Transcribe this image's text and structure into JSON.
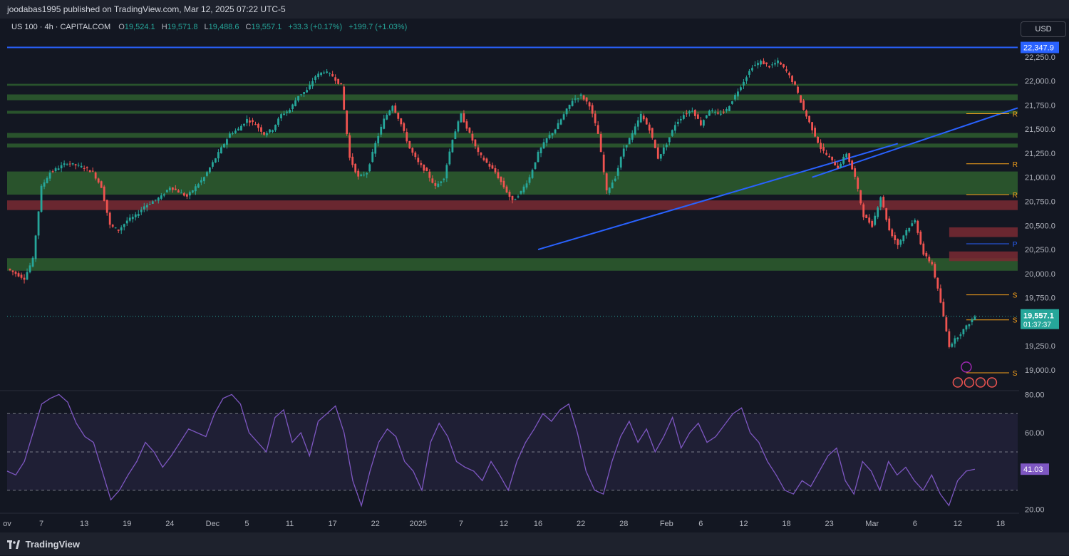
{
  "header": {
    "published_text": "joodabas1995 published on TradingView.com, Mar 12, 2025 07:22 UTC-5"
  },
  "legend": {
    "symbol": "US 100 · 4h · CAPITALCOM",
    "open_label": "O",
    "open": "19,524.1",
    "high_label": "H",
    "high": "19,571.8",
    "low_label": "L",
    "low": "19,488.6",
    "close_label": "C",
    "close": "19,557.1",
    "change": "+33.3 (+0.17%)",
    "change_2": "+199.7 (+1.03%)"
  },
  "currency_button": "USD",
  "footer": {
    "brand": "TradingView"
  },
  "colors": {
    "bg": "#131722",
    "up": "#26a69a",
    "down": "#ef5350",
    "green_zone": "#2e5e2e",
    "red_zone": "#7a2a33",
    "blue_line": "#2962ff",
    "orange": "#f7a21b",
    "rsi": "#7e57c2",
    "grid": "#2a2e39"
  },
  "chart_data": [
    {
      "type": "candlestick",
      "ylim": [
        18800,
        22500
      ],
      "y_ticks": [
        "22,250.0",
        "22,000.0",
        "21,750.0",
        "21,500.0",
        "21,250.0",
        "21,000.0",
        "20,750.0",
        "20,500.0",
        "20,250.0",
        "20,000.0",
        "19,750.0",
        "19,250.0",
        "19,000.0"
      ],
      "y_tick_values": [
        22250,
        22000,
        21750,
        21500,
        21250,
        21000,
        20750,
        20500,
        20250,
        20000,
        19750,
        19250,
        19000
      ],
      "x_ticks": [
        "ov",
        "7",
        "13",
        "19",
        "24",
        "Dec",
        "5",
        "11",
        "17",
        "22",
        "2025",
        "7",
        "12",
        "16",
        "22",
        "28",
        "Feb",
        "6",
        "12",
        "18",
        "23",
        "Mar",
        "6",
        "12",
        "18"
      ],
      "x_tick_index": [
        0,
        4,
        9,
        14,
        19,
        24,
        28,
        33,
        38,
        43,
        48,
        53,
        58,
        62,
        67,
        72,
        77,
        81,
        86,
        91,
        96,
        101,
        106,
        111,
        116
      ],
      "price_path": [
        [
          0,
          20050
        ],
        [
          2,
          19950
        ],
        [
          3,
          20150
        ],
        [
          4,
          20900
        ],
        [
          5,
          21050
        ],
        [
          7,
          21150
        ],
        [
          9,
          21100
        ],
        [
          10,
          21050
        ],
        [
          11,
          20900
        ],
        [
          12,
          20500
        ],
        [
          13,
          20450
        ],
        [
          14,
          20550
        ],
        [
          15,
          20600
        ],
        [
          16,
          20700
        ],
        [
          17,
          20750
        ],
        [
          18,
          20800
        ],
        [
          19,
          20900
        ],
        [
          20,
          20850
        ],
        [
          21,
          20800
        ],
        [
          22,
          20900
        ],
        [
          23,
          21000
        ],
        [
          24,
          21150
        ],
        [
          25,
          21300
        ],
        [
          26,
          21450
        ],
        [
          27,
          21500
        ],
        [
          28,
          21600
        ],
        [
          29,
          21550
        ],
        [
          30,
          21450
        ],
        [
          31,
          21500
        ],
        [
          32,
          21650
        ],
        [
          33,
          21700
        ],
        [
          34,
          21850
        ],
        [
          35,
          21900
        ],
        [
          36,
          22050
        ],
        [
          37,
          22100
        ],
        [
          38,
          22050
        ],
        [
          39,
          21950
        ],
        [
          40,
          21200
        ],
        [
          41,
          21000
        ],
        [
          42,
          21050
        ],
        [
          43,
          21350
        ],
        [
          44,
          21600
        ],
        [
          45,
          21750
        ],
        [
          46,
          21550
        ],
        [
          47,
          21300
        ],
        [
          48,
          21150
        ],
        [
          49,
          21050
        ],
        [
          50,
          20900
        ],
        [
          51,
          21000
        ],
        [
          52,
          21400
        ],
        [
          53,
          21650
        ],
        [
          54,
          21450
        ],
        [
          55,
          21250
        ],
        [
          56,
          21150
        ],
        [
          57,
          21050
        ],
        [
          58,
          20900
        ],
        [
          59,
          20750
        ],
        [
          60,
          20850
        ],
        [
          61,
          21000
        ],
        [
          62,
          21250
        ],
        [
          63,
          21400
        ],
        [
          64,
          21500
        ],
        [
          65,
          21650
        ],
        [
          66,
          21800
        ],
        [
          67,
          21850
        ],
        [
          68,
          21750
        ],
        [
          69,
          21450
        ],
        [
          70,
          20850
        ],
        [
          71,
          21000
        ],
        [
          72,
          21300
        ],
        [
          73,
          21450
        ],
        [
          74,
          21650
        ],
        [
          75,
          21500
        ],
        [
          76,
          21200
        ],
        [
          77,
          21350
        ],
        [
          78,
          21550
        ],
        [
          79,
          21650
        ],
        [
          80,
          21700
        ],
        [
          81,
          21550
        ],
        [
          82,
          21700
        ],
        [
          83,
          21650
        ],
        [
          84,
          21700
        ],
        [
          85,
          21850
        ],
        [
          86,
          22000
        ],
        [
          87,
          22150
        ],
        [
          88,
          22200
        ],
        [
          89,
          22150
        ],
        [
          90,
          22200
        ],
        [
          91,
          22100
        ],
        [
          92,
          21950
        ],
        [
          93,
          21700
        ],
        [
          94,
          21500
        ],
        [
          95,
          21300
        ],
        [
          96,
          21200
        ],
        [
          97,
          21100
        ],
        [
          98,
          21250
        ],
        [
          99,
          21000
        ],
        [
          100,
          20600
        ],
        [
          101,
          20500
        ],
        [
          102,
          20800
        ],
        [
          103,
          20450
        ],
        [
          104,
          20300
        ],
        [
          105,
          20450
        ],
        [
          106,
          20550
        ],
        [
          107,
          20200
        ],
        [
          108,
          20100
        ],
        [
          109,
          19700
        ],
        [
          110,
          19250
        ],
        [
          111,
          19350
        ],
        [
          112,
          19450
        ],
        [
          113,
          19557
        ]
      ],
      "last_price": "19,557.1",
      "countdown": "01:37:37",
      "top_line_label": "22,347.9",
      "top_line_value": 22347.9,
      "green_zones": [
        [
          21950,
          21970
        ],
        [
          21800,
          21860
        ],
        [
          21660,
          21690
        ],
        [
          21410,
          21460
        ],
        [
          21310,
          21350
        ],
        [
          20820,
          21060
        ],
        [
          20030,
          20160
        ]
      ],
      "red_zones": [
        [
          20660,
          20760
        ],
        [
          20380,
          20480
        ],
        [
          20130,
          20230
        ]
      ],
      "trendlines": [
        {
          "from": [
            62,
            20250
          ],
          "to": [
            104,
            21350
          ]
        },
        {
          "from": [
            94,
            21000
          ],
          "to": [
            118,
            21720
          ]
        }
      ],
      "levels": [
        {
          "value": 21660,
          "label": "R",
          "color": "#f7a21b"
        },
        {
          "value": 21140,
          "label": "R",
          "color": "#f7a21b"
        },
        {
          "value": 20820,
          "label": "R",
          "color": "#f7a21b"
        },
        {
          "value": 20310,
          "label": "P",
          "color": "#2962ff"
        },
        {
          "value": 19780,
          "label": "S",
          "color": "#f7a21b"
        },
        {
          "value": 19520,
          "label": "S",
          "color": "#f7a21b"
        },
        {
          "value": 18970,
          "label": "S",
          "color": "#f7a21b"
        }
      ]
    },
    {
      "type": "line",
      "indicator": "RSI",
      "ylim": [
        18,
        82
      ],
      "y_ticks": [
        "80.00",
        "60.00",
        "40.00",
        "20.00"
      ],
      "y_tick_values": [
        80,
        60,
        40,
        20
      ],
      "bands": [
        70,
        50,
        30
      ],
      "last_value": "41.03",
      "values": [
        40,
        38,
        45,
        60,
        75,
        78,
        80,
        76,
        65,
        58,
        55,
        40,
        25,
        30,
        38,
        45,
        55,
        50,
        42,
        48,
        55,
        62,
        60,
        58,
        70,
        78,
        80,
        75,
        60,
        55,
        50,
        68,
        72,
        55,
        60,
        48,
        66,
        70,
        74,
        60,
        35,
        22,
        40,
        55,
        62,
        58,
        45,
        40,
        30,
        55,
        65,
        58,
        45,
        42,
        40,
        35,
        45,
        38,
        30,
        45,
        55,
        62,
        70,
        66,
        72,
        75,
        60,
        40,
        30,
        28,
        45,
        58,
        66,
        55,
        62,
        50,
        58,
        68,
        52,
        60,
        65,
        55,
        58,
        64,
        70,
        73,
        60,
        55,
        45,
        38,
        30,
        28,
        35,
        32,
        40,
        48,
        52,
        35,
        28,
        45,
        40,
        30,
        45,
        38,
        42,
        35,
        30,
        38,
        28,
        22,
        35,
        40,
        41
      ]
    }
  ]
}
